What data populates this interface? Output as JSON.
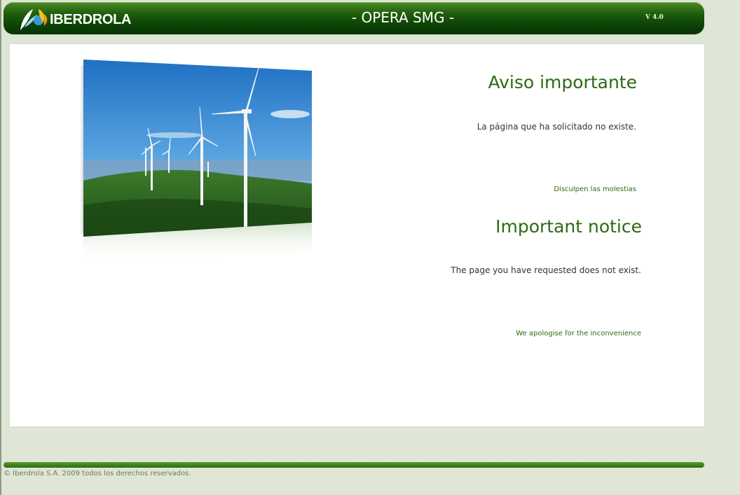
{
  "header": {
    "logo_text": "IBERDROLA",
    "app_title": "- OPERA SMG -",
    "version": "V 4.0"
  },
  "notice_es": {
    "title": "Aviso importante",
    "message": "La página que ha solicitado no existe.",
    "apology": "Disculpen las molestias"
  },
  "notice_en": {
    "title": "Important notice",
    "message": "The page you have requested does not exist.",
    "apology": "We apologise for the inconvenience"
  },
  "footer": {
    "copyright": "© Iberdrola S.A. 2009 todos los derechos reservados."
  },
  "colors": {
    "brand_green": "#2d6a12",
    "header_dark_green": "#0c4306",
    "page_background": "#dfe6d6"
  },
  "images": {
    "hero": "wind-turbines-photo"
  }
}
